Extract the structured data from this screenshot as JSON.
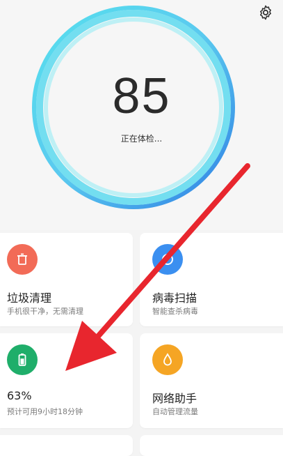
{
  "header": {
    "settings_icon": "gear-icon"
  },
  "checkup": {
    "score": "85",
    "status": "正在体检..."
  },
  "cards": [
    {
      "id": "junk",
      "title": "垃圾清理",
      "subtitle": "手机很干净，无需清理",
      "icon": "trash-icon",
      "color": "#f26b57"
    },
    {
      "id": "virus",
      "title": "病毒扫描",
      "subtitle": "智能查杀病毒",
      "icon": "scan-icon",
      "color": "#3b8ff0"
    },
    {
      "id": "battery",
      "title": "63%",
      "subtitle": "预计可用9小时18分钟",
      "icon": "battery-icon",
      "color": "#1fae6a",
      "level": 0.63
    },
    {
      "id": "network",
      "title": "网络助手",
      "subtitle": "自动管理流量",
      "icon": "droplet-icon",
      "color": "#f5a524"
    }
  ],
  "annotation": {
    "arrow_color": "#e8262e"
  }
}
